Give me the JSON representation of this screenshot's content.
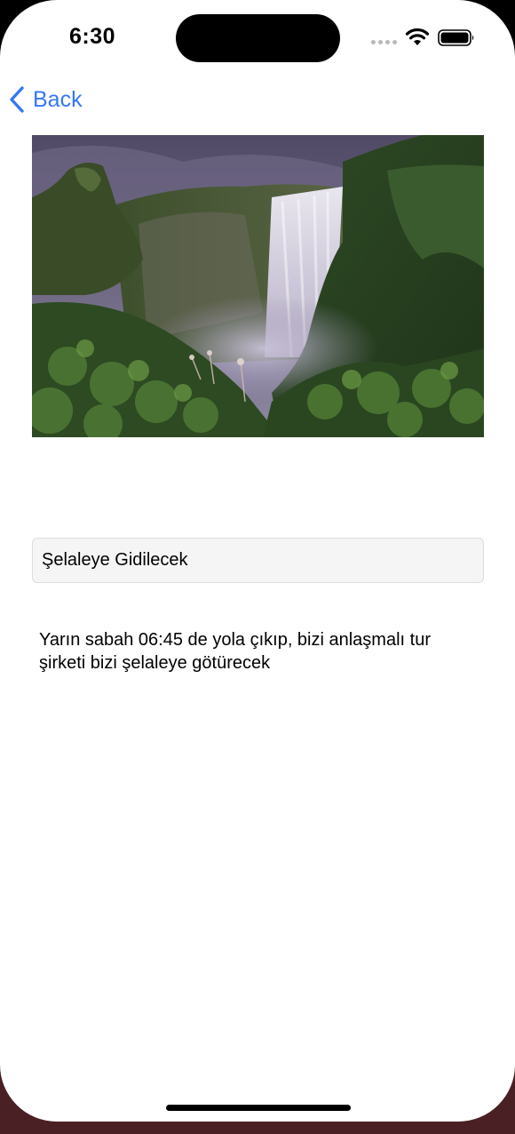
{
  "status_bar": {
    "time": "6:30",
    "icons": [
      "signal-icon",
      "wifi-icon",
      "battery-icon"
    ]
  },
  "nav": {
    "back_label": "Back",
    "back_icon": "chevron-left-icon",
    "accent_color": "#3478f6"
  },
  "content": {
    "image": "waterfall-photo",
    "title_value": "Şelaleye Gidilecek",
    "description": "Yarın sabah 06:45 de yola çıkıp, bizi anlaşmalı tur\nşirketi bizi şelaleye götürecek"
  }
}
